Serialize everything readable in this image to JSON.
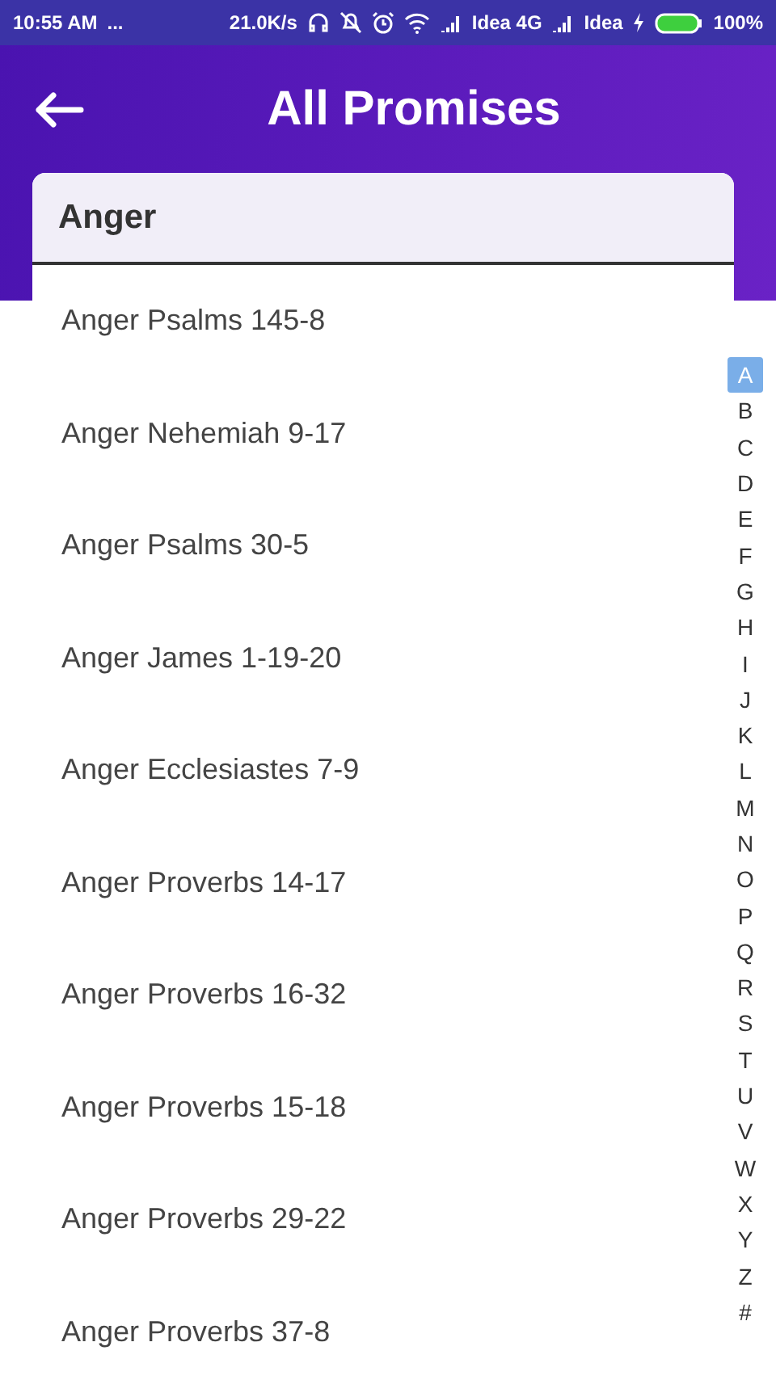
{
  "status_bar": {
    "time": "10:55 AM",
    "dots": "...",
    "speed": "21.0K/s",
    "carrier_1": "Idea 4G",
    "carrier_2": "Idea",
    "battery": "100%"
  },
  "app_bar": {
    "title": "All Promises"
  },
  "section": {
    "title": "Anger"
  },
  "promises": [
    "Anger Psalms 145-8",
    "Anger Nehemiah 9-17",
    "Anger Psalms 30-5",
    "Anger James 1-19-20",
    "Anger Ecclesiastes 7-9",
    "Anger Proverbs 14-17",
    "Anger Proverbs 16-32",
    "Anger Proverbs 15-18",
    "Anger Proverbs 29-22",
    "Anger Proverbs 37-8"
  ],
  "index": [
    {
      "letter": "A",
      "selected": true
    },
    {
      "letter": "B",
      "selected": false
    },
    {
      "letter": "C",
      "selected": false
    },
    {
      "letter": "D",
      "selected": false
    },
    {
      "letter": "E",
      "selected": false
    },
    {
      "letter": "F",
      "selected": false
    },
    {
      "letter": "G",
      "selected": false
    },
    {
      "letter": "H",
      "selected": false
    },
    {
      "letter": "I",
      "selected": false
    },
    {
      "letter": "J",
      "selected": false
    },
    {
      "letter": "K",
      "selected": false
    },
    {
      "letter": "L",
      "selected": false
    },
    {
      "letter": "M",
      "selected": false
    },
    {
      "letter": "N",
      "selected": false
    },
    {
      "letter": "O",
      "selected": false
    },
    {
      "letter": "P",
      "selected": false
    },
    {
      "letter": "Q",
      "selected": false
    },
    {
      "letter": "R",
      "selected": false
    },
    {
      "letter": "S",
      "selected": false
    },
    {
      "letter": "T",
      "selected": false
    },
    {
      "letter": "U",
      "selected": false
    },
    {
      "letter": "V",
      "selected": false
    },
    {
      "letter": "W",
      "selected": false
    },
    {
      "letter": "X",
      "selected": false
    },
    {
      "letter": "Y",
      "selected": false
    },
    {
      "letter": "Z",
      "selected": false
    },
    {
      "letter": "#",
      "selected": false
    }
  ]
}
